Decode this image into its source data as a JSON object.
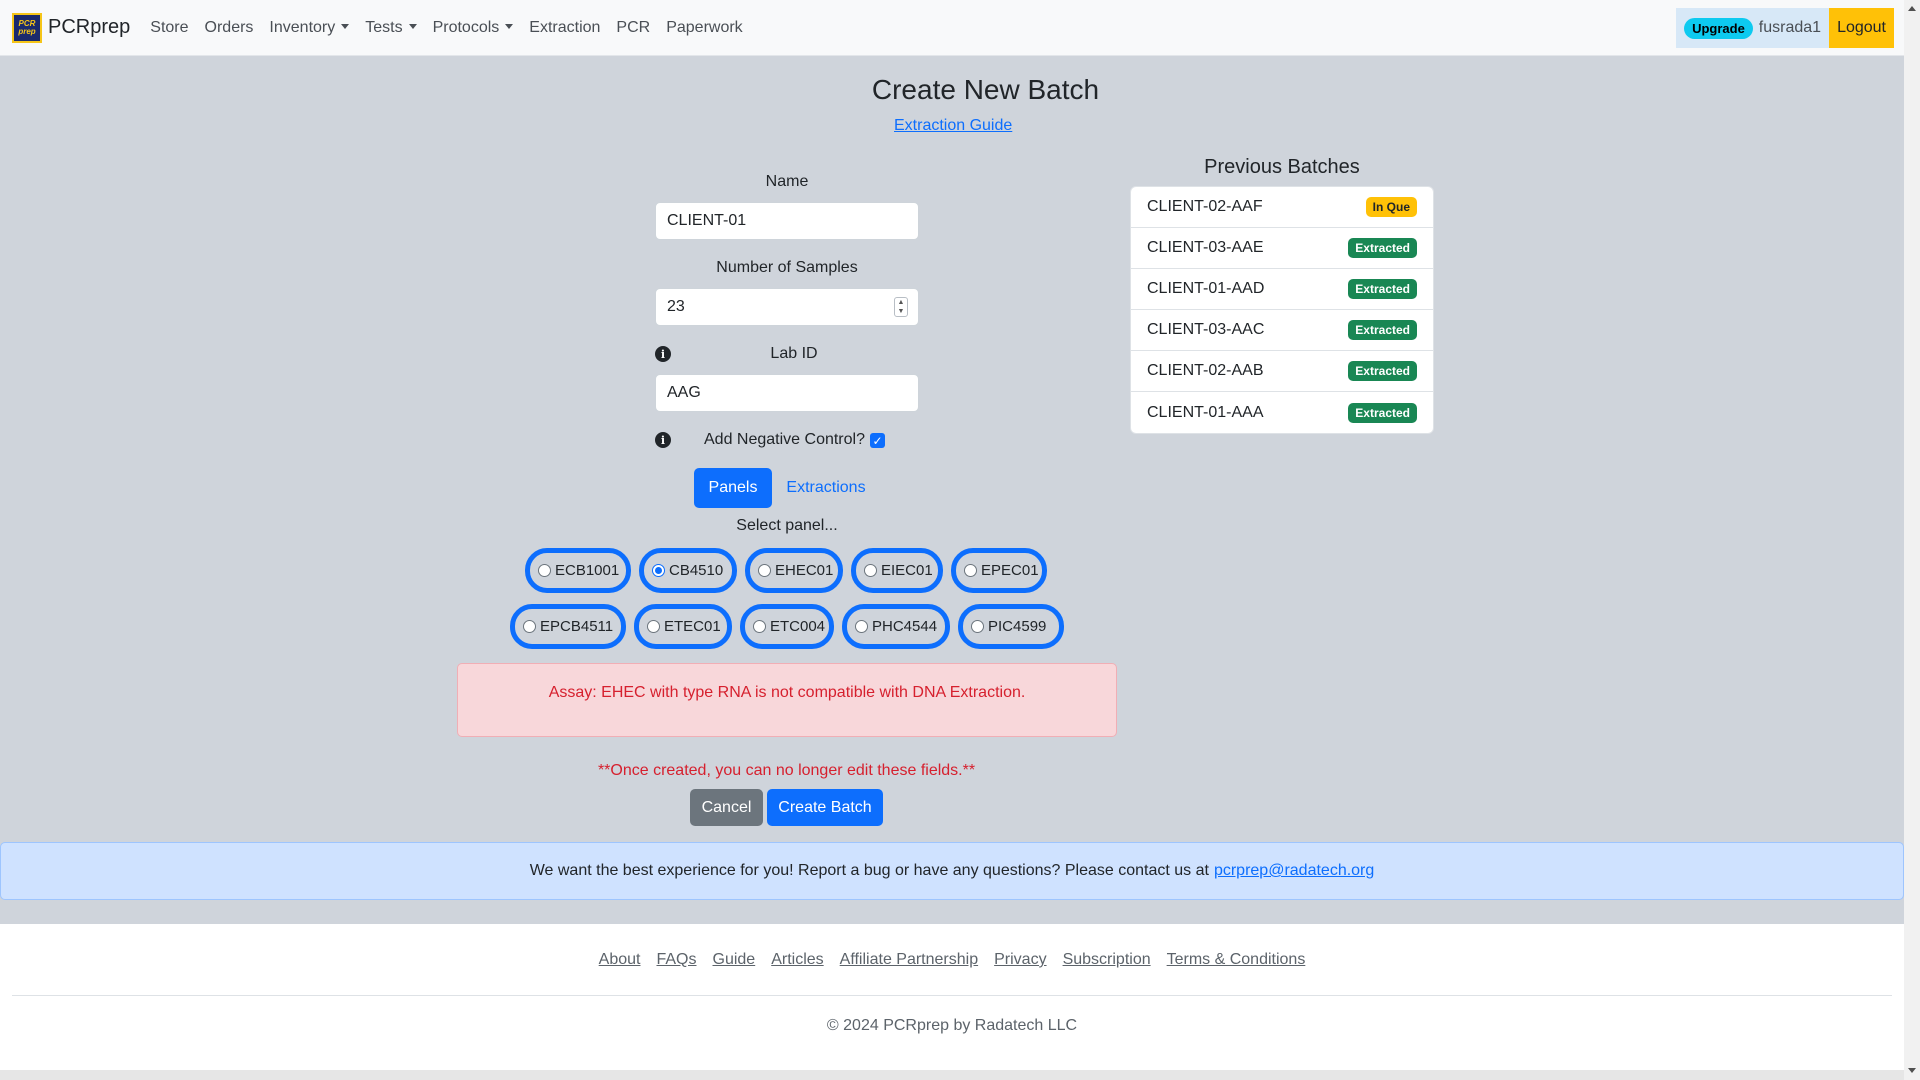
{
  "nav": {
    "brand": "PCRprep",
    "brand_logo_text": "PCR prep",
    "links": [
      {
        "label": "Store",
        "dropdown": false
      },
      {
        "label": "Orders",
        "dropdown": false
      },
      {
        "label": "Inventory",
        "dropdown": true
      },
      {
        "label": "Tests",
        "dropdown": true
      },
      {
        "label": "Protocols",
        "dropdown": true
      },
      {
        "label": "Extraction",
        "dropdown": false
      },
      {
        "label": "PCR",
        "dropdown": false
      },
      {
        "label": "Paperwork",
        "dropdown": false
      }
    ],
    "upgrade": "Upgrade",
    "username": "fusrada1",
    "logout": "Logout"
  },
  "page": {
    "title": "Create New Batch",
    "guide_link": "Extraction Guide"
  },
  "form": {
    "name_label": "Name",
    "name_value": "CLIENT-01",
    "samples_label": "Number of Samples",
    "samples_value": "23",
    "lab_id_label": "Lab ID",
    "lab_id_value": "AAG",
    "negative_control_label": "Add Negative Control?",
    "negative_control_checked": true,
    "tabs": {
      "panels": "Panels",
      "extractions": "Extractions",
      "active": "panels"
    },
    "select_panel_label": "Select panel...",
    "panels": [
      {
        "label": "ECB1001",
        "checked": false
      },
      {
        "label": "CB4510",
        "checked": true
      },
      {
        "label": "EHEC01",
        "checked": false
      },
      {
        "label": "EIEC01",
        "checked": false
      },
      {
        "label": "EPEC01",
        "checked": false
      },
      {
        "label": "EPCB4511",
        "checked": false
      },
      {
        "label": "ETEC01",
        "checked": false
      },
      {
        "label": "ETC004",
        "checked": false
      },
      {
        "label": "PHC4544",
        "checked": false
      },
      {
        "label": "PIC4599",
        "checked": false
      }
    ],
    "alert": "Assay: EHEC with type RNA is not compatible with DNA Extraction.",
    "warning": "**Once created, you can no longer edit these fields.**",
    "cancel": "Cancel",
    "create": "Create Batch"
  },
  "previous_batches": {
    "title": "Previous Batches",
    "items": [
      {
        "name": "CLIENT-02-AAF",
        "status": "In Que"
      },
      {
        "name": "CLIENT-03-AAE",
        "status": "Extracted"
      },
      {
        "name": "CLIENT-01-AAD",
        "status": "Extracted"
      },
      {
        "name": "CLIENT-03-AAC",
        "status": "Extracted"
      },
      {
        "name": "CLIENT-02-AAB",
        "status": "Extracted"
      },
      {
        "name": "CLIENT-01-AAA",
        "status": "Extracted"
      }
    ],
    "status_colors": {
      "In Que": "#ffc107",
      "Extracted": "#198754"
    }
  },
  "contact": {
    "text": "We want the best experience for you! Report a bug or have any questions? Please contact us at",
    "email": "pcrprep@radatech.org"
  },
  "footer": {
    "links": [
      "About",
      "FAQs",
      "Guide",
      "Articles",
      "Affiliate Partnership",
      "Privacy",
      "Subscription",
      "Terms & Conditions"
    ],
    "copyright": "© 2024 PCRprep by Radatech LLC"
  },
  "icons": {
    "info": "info-icon",
    "caret": "chevron-down-icon",
    "spinner": "stepper-icon",
    "check": "checkmark-icon"
  },
  "colors": {
    "primary": "#0d6efd",
    "warning": "#ffc107",
    "success": "#198754",
    "danger": "#d6202e",
    "secondary": "#6c757d",
    "page_background": "#cfd4db"
  }
}
